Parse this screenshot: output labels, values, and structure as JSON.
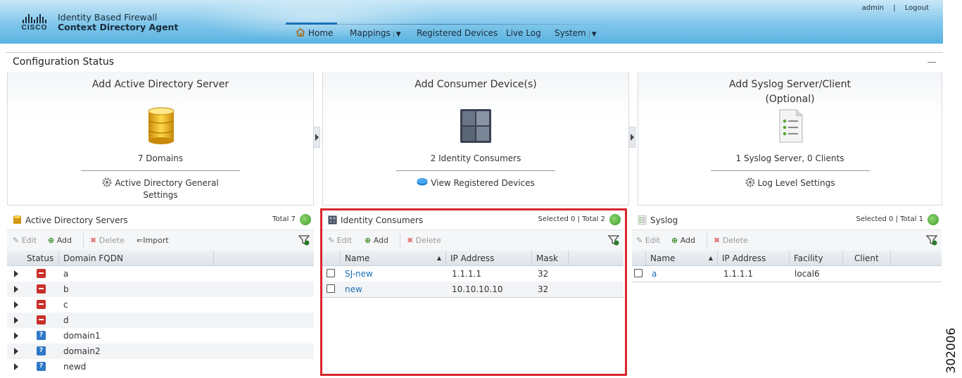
{
  "header": {
    "brand": "CISCO",
    "title_line1": "Identity Based Firewall",
    "title_line2": "Context Directory Agent",
    "user": "admin",
    "separator": "|",
    "logout": "Logout"
  },
  "nav": {
    "home": "Home",
    "mappings": "Mappings",
    "registered_devices": "Registered Devices",
    "live_log": "Live Log",
    "system": "System"
  },
  "config": {
    "title": "Configuration Status",
    "cards": [
      {
        "title": "Add Active Directory Server",
        "count": "7 Domains",
        "link_line1": "Active Directory General",
        "link_line2": "Settings"
      },
      {
        "title": "Add Consumer Device(s)",
        "count": "2 Identity Consumers",
        "link_line1": "View Registered Devices"
      },
      {
        "title_line1": "Add Syslog Server/Client",
        "title_line2": "(Optional)",
        "count": "1 Syslog Server, 0 Clients",
        "link_line1": "Log Level Settings"
      }
    ]
  },
  "ad_panel": {
    "title": "Active Directory Servers",
    "total": "Total 7",
    "toolbar": {
      "edit": "Edit",
      "add": "Add",
      "delete": "Delete",
      "import": "Import"
    },
    "columns": [
      "Status",
      "Domain FQDN"
    ],
    "rows": [
      {
        "status": "error",
        "fqdn": "a"
      },
      {
        "status": "error",
        "fqdn": "b"
      },
      {
        "status": "error",
        "fqdn": "c"
      },
      {
        "status": "error",
        "fqdn": "d"
      },
      {
        "status": "unknown",
        "fqdn": "domain1"
      },
      {
        "status": "unknown",
        "fqdn": "domain2"
      },
      {
        "status": "unknown",
        "fqdn": "newd"
      }
    ],
    "status_unknown_glyph": "?"
  },
  "ic_panel": {
    "title": "Identity Consumers",
    "totals": "Selected 0 | Total 2",
    "toolbar": {
      "edit": "Edit",
      "add": "Add",
      "delete": "Delete"
    },
    "columns": [
      "Name",
      "IP Address",
      "Mask"
    ],
    "rows": [
      {
        "name": "SJ-new",
        "ip": "1.1.1.1",
        "mask": "32"
      },
      {
        "name": "new",
        "ip": "10.10.10.10",
        "mask": "32"
      }
    ]
  },
  "syslog_panel": {
    "title": "Syslog",
    "totals": "Selected 0 | Total 1",
    "toolbar": {
      "edit": "Edit",
      "add": "Add",
      "delete": "Delete"
    },
    "columns": [
      "Name",
      "IP Address",
      "Facility",
      "Client"
    ],
    "rows": [
      {
        "name": "a",
        "ip": "1.1.1.1",
        "facility": "local6",
        "client": ""
      }
    ]
  },
  "figure_id": "302006",
  "colors": {
    "highlight": "#d8262e",
    "link": "#1a6fb5",
    "error": "#c8302a",
    "unknown": "#2f78c8"
  }
}
